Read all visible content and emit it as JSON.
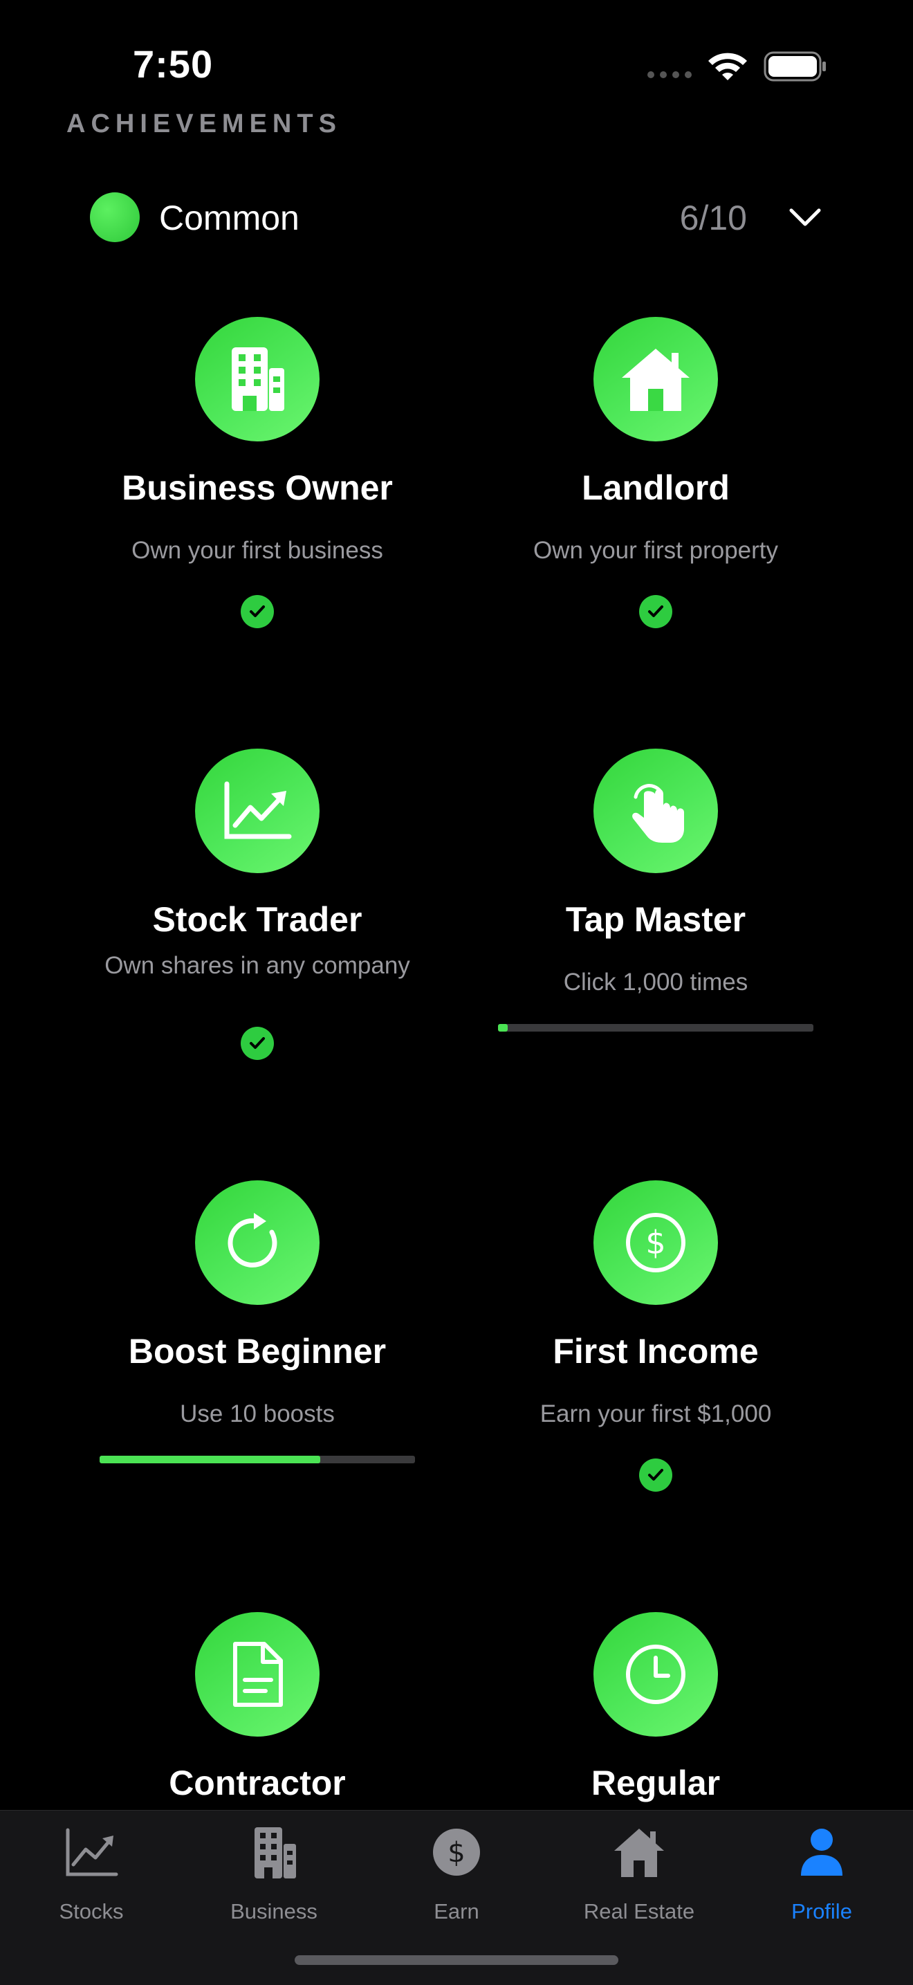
{
  "status_bar": {
    "time": "7:50"
  },
  "section": {
    "title": "ACHIEVEMENTS"
  },
  "category": {
    "label": "Common",
    "count": "6/10",
    "dot_color": "#3ddc47"
  },
  "achievements": [
    {
      "title": "Business Owner",
      "description": "Own your first business",
      "icon": "building-icon",
      "completed": true
    },
    {
      "title": "Landlord",
      "description": "Own your first property",
      "icon": "house-icon",
      "completed": true
    },
    {
      "title": "Stock Trader",
      "description": "Own shares in any company",
      "icon": "chart-up-icon",
      "completed": true
    },
    {
      "title": "Tap Master",
      "description": "Click 1,000 times",
      "icon": "tap-hand-icon",
      "completed": false,
      "progress": 0.03
    },
    {
      "title": "Boost Beginner",
      "description": "Use 10 boosts",
      "icon": "refresh-icon",
      "completed": false,
      "progress": 0.7
    },
    {
      "title": "First Income",
      "description": "Earn your first $1,000",
      "icon": "dollar-circle-icon",
      "completed": true
    },
    {
      "title": "Contractor",
      "description": "",
      "icon": "document-icon"
    },
    {
      "title": "Regular",
      "description": "",
      "icon": "clock-icon"
    }
  ],
  "tabbar": {
    "items": [
      {
        "label": "Stocks",
        "icon": "chart-icon"
      },
      {
        "label": "Business",
        "icon": "building-icon"
      },
      {
        "label": "Earn",
        "icon": "dollar-icon"
      },
      {
        "label": "Real Estate",
        "icon": "house-icon"
      },
      {
        "label": "Profile",
        "icon": "person-icon",
        "active": true
      }
    ],
    "active_color": "#1a82ff",
    "inactive_color": "#8e8e93"
  },
  "accent_green": "#3ddc47"
}
